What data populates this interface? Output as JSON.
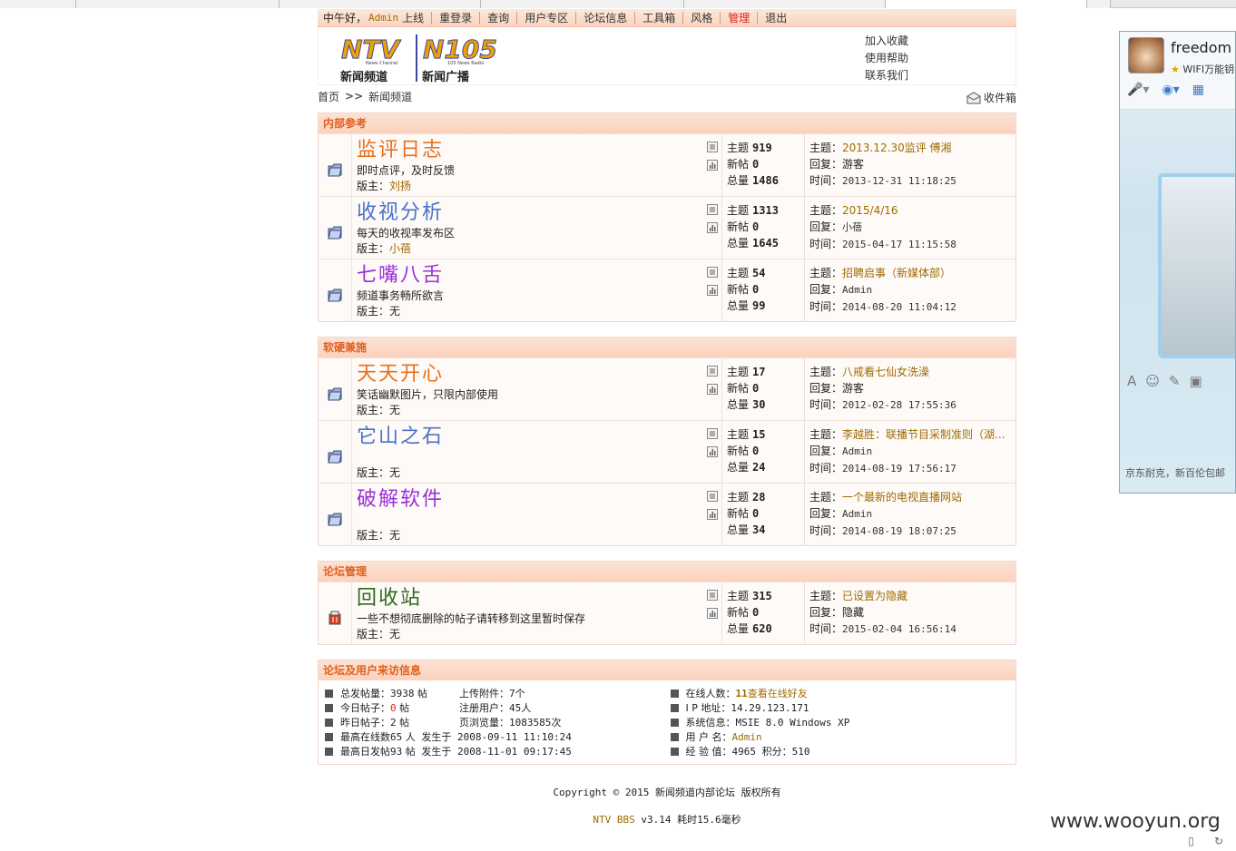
{
  "nav": {
    "greeting": "中午好，",
    "user": "Admin",
    "items": [
      {
        "label": "上线",
        "name": "nav-online"
      },
      {
        "label": "重登录",
        "name": "nav-relogin"
      },
      {
        "label": "查询",
        "name": "nav-search"
      },
      {
        "label": "用户专区",
        "name": "nav-user-zone"
      },
      {
        "label": "论坛信息",
        "name": "nav-forum-info"
      },
      {
        "label": "工具箱",
        "name": "nav-toolbox"
      },
      {
        "label": "风格",
        "name": "nav-style"
      },
      {
        "label": "管理",
        "name": "nav-admin"
      },
      {
        "label": "退出",
        "name": "nav-logout"
      }
    ]
  },
  "header": {
    "logo1_label": "新闻频道",
    "logo1_sub": "News Channel",
    "logo2_label": "新闻广播",
    "logo2_sub": "105 News Radio",
    "links": [
      "加入收藏",
      "使用帮助",
      "联系我们"
    ]
  },
  "breadcrumb": {
    "home": "首页",
    "sep": ">>",
    "current": "新闻频道",
    "inbox": "收件箱"
  },
  "labels": {
    "topics": "主题",
    "new": "新帖",
    "total": "总量",
    "last_topic": "主题：",
    "last_reply": "回复：",
    "last_time": "时间：",
    "mod": "版主："
  },
  "categories": [
    {
      "title": "内部参考",
      "forums": [
        {
          "name": "监评日志",
          "color": "#e8701a",
          "desc": "即时点评，及时反馈",
          "mod": "刘扬",
          "mod_link": true,
          "topics": "919",
          "new": "0",
          "total": "1486",
          "last_topic": "2013.12.30监评 傅湘",
          "last_reply": "游客",
          "last_reply_link": false,
          "last_time": "2013-12-31 11:18:25"
        },
        {
          "name": "收视分析",
          "color": "#4a72c8",
          "desc": "每天的收视率发布区",
          "mod": "小蓓",
          "mod_link": true,
          "topics": "1313",
          "new": "0",
          "total": "1645",
          "last_topic": "2015/4/16",
          "last_reply": "小蓓",
          "last_reply_link": true,
          "last_time": "2015-04-17 11:15:58"
        },
        {
          "name": "七嘴八舌",
          "color": "#9b30d8",
          "desc": "频道事务畅所欲言",
          "mod": "无",
          "mod_link": false,
          "topics": "54",
          "new": "0",
          "total": "99",
          "last_topic": "招聘启事（新媒体部）",
          "last_reply": "Admin",
          "last_reply_link": true,
          "last_time": "2014-08-20 11:04:12"
        }
      ]
    },
    {
      "title": "软硬兼施",
      "forums": [
        {
          "name": "天天开心",
          "color": "#e8701a",
          "desc": "笑话幽默图片，只限内部使用",
          "mod": "无",
          "mod_link": false,
          "topics": "17",
          "new": "0",
          "total": "30",
          "last_topic": "八戒看七仙女洗澡",
          "last_reply": "游客",
          "last_reply_link": false,
          "last_time": "2012-02-28 17:55:36"
        },
        {
          "name": "它山之石",
          "color": "#4a72c8",
          "desc": "",
          "mod": "无",
          "mod_link": false,
          "topics": "15",
          "new": "0",
          "total": "24",
          "last_topic": "李越胜：联播节目采制准则（湖...",
          "last_reply": "Admin",
          "last_reply_link": true,
          "last_time": "2014-08-19 17:56:17"
        },
        {
          "name": "破解软件",
          "color": "#9b30d8",
          "desc": "",
          "mod": "无",
          "mod_link": false,
          "topics": "28",
          "new": "0",
          "total": "34",
          "last_topic": "一个最新的电视直播网站",
          "last_reply": "Admin",
          "last_reply_link": true,
          "last_time": "2014-08-19 18:07:25"
        }
      ]
    },
    {
      "title": "论坛管理",
      "forums": [
        {
          "name": "回收站",
          "color": "#2f6b1a",
          "desc": "一些不想彻底删除的帖子请转移到这里暂时保存",
          "mod": "无",
          "mod_link": false,
          "topics": "315",
          "new": "0",
          "total": "620",
          "last_topic": "已设置为隐藏",
          "last_reply": "隐藏",
          "last_reply_link": false,
          "last_time": "2015-02-04 16:56:14",
          "trash": true
        }
      ]
    }
  ],
  "info": {
    "title": "论坛及用户来访信息",
    "left": [
      {
        "label": "总发帖量：",
        "value": "3938",
        "unit": "帖",
        "label2": "上传附件：",
        "value2": "7",
        "unit2": "个"
      },
      {
        "label": "今日帖子：",
        "value": "0",
        "unit": "帖",
        "label2": "注册用户：",
        "value2": "45",
        "unit2": "人"
      },
      {
        "label": "昨日帖子：",
        "value": "2",
        "unit": "帖",
        "label2": "页浏览量：",
        "value2": "1083585",
        "unit2": "次"
      },
      {
        "label": "最高在线数",
        "value": "65",
        "unit": "人 发生于 2008-09-11 11:10:24"
      },
      {
        "label": "最高日发帖",
        "value": "93",
        "unit": "帖 发生于 2008-11-01 09:17:45"
      }
    ],
    "right": [
      {
        "label": "在线人数：",
        "value": "11",
        "extra": "查看在线好友"
      },
      {
        "label": "I P 地址：",
        "value": "14.29.123.171"
      },
      {
        "label": "系统信息：",
        "value": "MSIE 8.0 Windows XP"
      },
      {
        "label": "用 户 名：",
        "value": "Admin"
      },
      {
        "label": "经 验 值：",
        "value": "4965 积分：510"
      }
    ]
  },
  "footer": {
    "copyright": "Copyright © 2015 新闻频道内部论坛 版权所有",
    "app": "NTV BBS",
    "version": "v3.14 耗时15.6毫秒"
  },
  "qq": {
    "nick": "freedom",
    "signature": "WIFI万能钥",
    "ad": "京东耐克，新百伦包邮"
  },
  "watermark": "www.wooyun.org"
}
